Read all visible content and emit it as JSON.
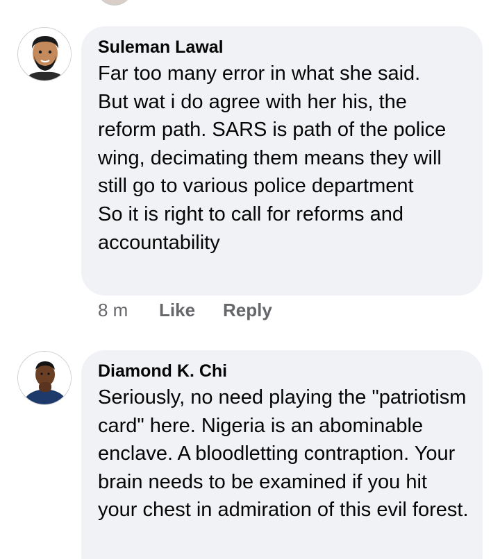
{
  "comments": [
    {
      "author": "Suleman Lawal",
      "avatar_icon": "bitmoji-avatar-icon",
      "text": "Far too many error in what she said.\nBut wat i do agree with her his, the reform path. SARS is path of the police wing, decimating them means they will still go to various police department\nSo it is right to call for reforms and accountability",
      "time": "8 m",
      "like_label": "Like",
      "reply_label": "Reply"
    },
    {
      "author": "Diamond K. Chi",
      "avatar_icon": "user-photo-avatar-icon",
      "text": "Seriously, no need playing the \"patriotism card\" here. Nigeria is an abominable enclave. A bloodletting contraption. Your brain needs to be examined if you hit your chest in admiration of this evil forest."
    }
  ]
}
